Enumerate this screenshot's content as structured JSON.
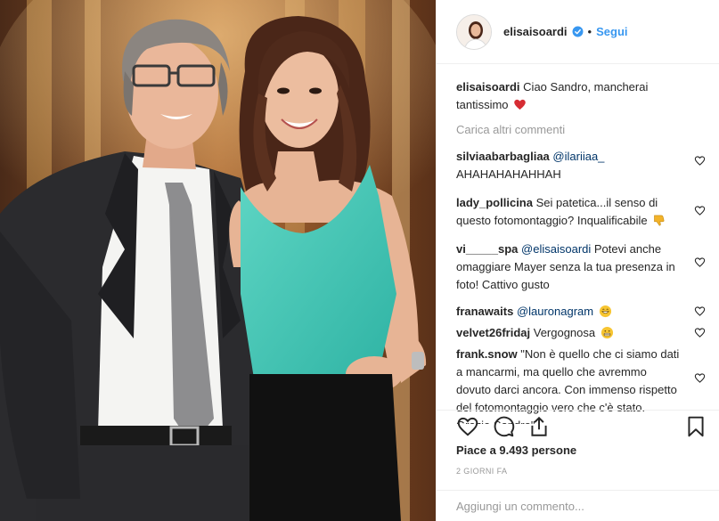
{
  "header": {
    "username": "elisaisoardi",
    "separator": "•",
    "follow_label": "Segui",
    "verified_icon": "verified-badge-icon"
  },
  "caption": {
    "username": "elisaisoardi",
    "text": "Ciao Sandro, mancherai tantissimo",
    "emoji": "red-heart-emoji"
  },
  "load_more_label": "Carica altri commenti",
  "comments": [
    {
      "username": "silviaabarbagliaa",
      "mention": "@ilariiaa_",
      "text": "AHAHAHAHAHHAH"
    },
    {
      "username": "lady_pollicina",
      "text": "Sei patetica...il senso di questo fotomontaggio? Inqualificabile",
      "emoji": "thumbs-down-emoji"
    },
    {
      "username": "vi_____spa",
      "mention": "@elisaisoardi",
      "text": "Potevi anche omaggiare Mayer senza la tua presenza in foto! Cattivo gusto"
    },
    {
      "username": "franawaits",
      "mention": "@lauronagram",
      "emoji": "grinning-emoji"
    },
    {
      "username": "velvet26fridaj",
      "text": "Vergognosa",
      "emoji": "grimacing-emoji"
    },
    {
      "username": "frank.snow",
      "text": "\"Non è quello che ci siamo dati a mancarmi, ma quello che avremmo dovuto darci ancora. Con immenso rispetto del fotomontaggio vero che c'è stato. Grazie Sandro\"."
    }
  ],
  "likes_text": "Piace a 9.493 persone",
  "timestamp": "2 GIORNI FA",
  "add_comment_placeholder": "Aggiungi un commento...",
  "icons": {
    "like": "heart-outline-icon",
    "comment": "comment-bubble-icon",
    "share": "share-icon",
    "save": "bookmark-icon",
    "comment_like": "heart-outline-small-icon"
  },
  "colors": {
    "follow_blue": "#3897f0",
    "mention_blue": "#003569",
    "verified_blue": "#3897f0",
    "muted_gray": "#999999",
    "border": "#efefef"
  }
}
